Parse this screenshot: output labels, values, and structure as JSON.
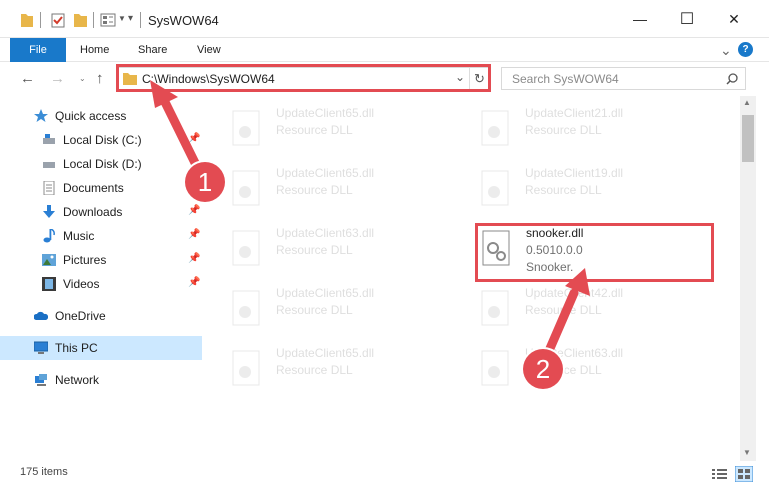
{
  "window": {
    "title": "SysWOW64",
    "minimize": "—",
    "maximize": "☐",
    "close": "✕"
  },
  "ribbon": {
    "tabs": [
      "File",
      "Home",
      "Share",
      "View"
    ],
    "help": "?",
    "expand": "⌄"
  },
  "nav": {
    "address": "C:\\Windows\\SysWOW64",
    "search_placeholder": "Search SysWOW64"
  },
  "sidebar": {
    "items": [
      {
        "label": "Quick access",
        "icon": "star-icon"
      },
      {
        "label": "Local Disk (C:)",
        "icon": "drive-icon"
      },
      {
        "label": "Local Disk (D:)",
        "icon": "drive-icon"
      },
      {
        "label": "Documents",
        "icon": "documents-icon"
      },
      {
        "label": "Downloads",
        "icon": "downloads-icon"
      },
      {
        "label": "Music",
        "icon": "music-icon"
      },
      {
        "label": "Pictures",
        "icon": "pictures-icon"
      },
      {
        "label": "Videos",
        "icon": "videos-icon"
      },
      {
        "label": "OneDrive",
        "icon": "cloud-icon"
      },
      {
        "label": "This PC",
        "icon": "computer-icon"
      },
      {
        "label": "Network",
        "icon": "network-icon"
      }
    ]
  },
  "files": {
    "left": [
      {
        "name": "UpdateClient65.dll",
        "type": "Resource DLL"
      },
      {
        "name": "UpdateClient65.dll",
        "type": "Resource DLL"
      },
      {
        "name": "UpdateClient63.dll",
        "type": "Resource DLL"
      },
      {
        "name": "UpdateClient65.dll",
        "type": "Resource DLL"
      },
      {
        "name": "UpdateClient65.dll",
        "type": "Resource DLL"
      }
    ],
    "right": [
      {
        "name": "UpdateClient21.dll",
        "type": "Resource DLL"
      },
      {
        "name": "UpdateClient19.dll",
        "type": "Resource DLL"
      },
      {
        "name": "UpdateClient42.dll",
        "type": "Resource DLL"
      },
      {
        "name": "UpdateClient63.dll",
        "type": "Resource DLL"
      }
    ],
    "highlight": {
      "name": "snooker.dll",
      "version": "0.5010.0.0",
      "description": "Snooker."
    }
  },
  "callouts": [
    "1",
    "2"
  ],
  "status": {
    "count": "175 items"
  },
  "colors": {
    "accent": "#1979ca",
    "annotation": "#e34b52",
    "selected": "#cce8ff"
  }
}
